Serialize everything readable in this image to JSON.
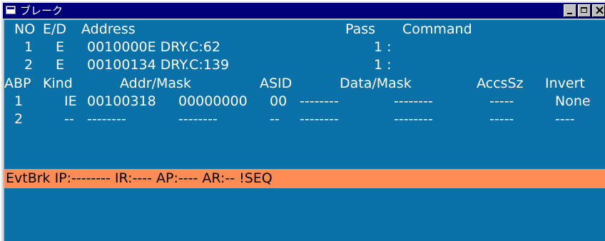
{
  "window": {
    "title": "ブレーク"
  },
  "bp_header": {
    "no": "NO",
    "ed": "E/D",
    "address": "Address",
    "pass": "Pass",
    "command": "Command"
  },
  "breakpoints": [
    {
      "no": "1",
      "ed": "E",
      "address": "0010000E DRY.C:62",
      "pass": "1 :"
    },
    {
      "no": "2",
      "ed": "E",
      "address": "00100134 DRY.C:139",
      "pass": "1 :"
    }
  ],
  "abp_header": {
    "abp": "ABP",
    "kind": "Kind",
    "addr_mask": "Addr/Mask",
    "asid": "ASID",
    "data_mask": "Data/Mask",
    "accssz": "AccsSz",
    "invert": "Invert"
  },
  "abps": [
    {
      "abp": "1",
      "kind": "IE",
      "addr": "00100318",
      "mask": "00000000",
      "asid": "00",
      "data": "--------",
      "datamask": "--------",
      "accssz": "-----",
      "invert": "None"
    },
    {
      "abp": "2",
      "kind": "--",
      "addr": "--------",
      "mask": "--------",
      "asid": "--",
      "data": "--------",
      "datamask": "--------",
      "accssz": "-----",
      "invert": "----"
    }
  ],
  "event_break": "EvtBrk IP:-------- IR:---- AP:---- AR:-- !SEQ",
  "colors": {
    "titlebar": "#00007b",
    "content_bg": "#0a71a8",
    "event_bar": "#ff8c55"
  }
}
